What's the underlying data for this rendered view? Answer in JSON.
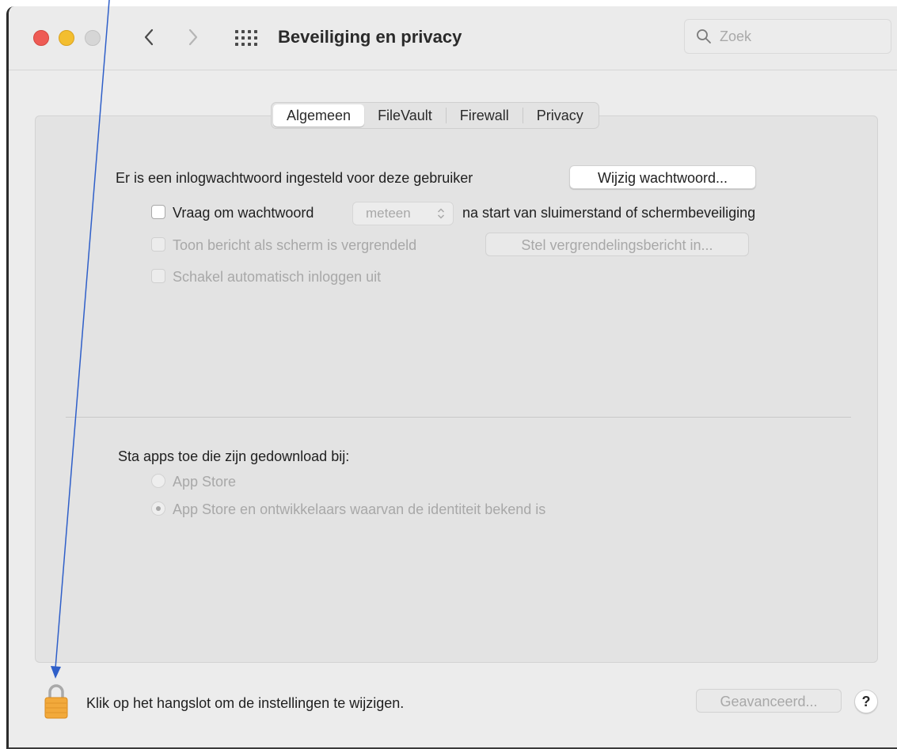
{
  "window": {
    "title": "Beveiliging en privacy",
    "search_placeholder": "Zoek"
  },
  "tabs": [
    "Algemeen",
    "FileVault",
    "Firewall",
    "Privacy"
  ],
  "active_tab": "Algemeen",
  "general": {
    "login_password_text": "Er is een inlogwachtwoord ingesteld voor deze gebruiker",
    "change_password_button": "Wijzig wachtwoord...",
    "require_password_label": "Vraag om wachtwoord",
    "require_password_select_value": "meteen",
    "require_password_suffix": "na start van sluimerstand of schermbeveiliging",
    "show_message_label": "Toon bericht als scherm is vergrendeld",
    "set_lock_message_button": "Stel vergrendelingsbericht in...",
    "disable_auto_login_label": "Schakel automatisch inloggen uit"
  },
  "downloads": {
    "heading": "Sta apps toe die zijn gedownload bij:",
    "options": [
      "App Store",
      "App Store en ontwikkelaars waarvan de identiteit bekend is"
    ],
    "selected_index": 1
  },
  "footer": {
    "lock_text": "Klik op het hangslot om de instellingen te wijzigen.",
    "advanced_button": "Geavanceerd...",
    "help_button": "?"
  },
  "colors": {
    "close": "#ee5b55",
    "minimize": "#f3be2f",
    "zoom_inactive": "#d6d6d6",
    "lock": "#f2a93b",
    "annotation_arrow": "#2f5fc9"
  },
  "icons": {
    "back": "chevron-left-icon",
    "forward": "chevron-right-icon",
    "show_all": "grid-icon",
    "search": "search-icon",
    "lock": "padlock-icon"
  }
}
